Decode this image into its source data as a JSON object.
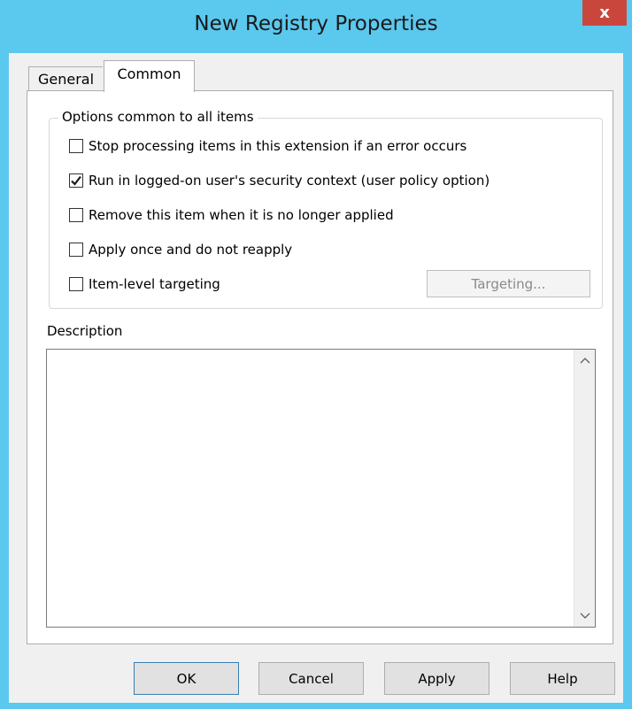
{
  "window": {
    "title": "New Registry Properties",
    "close_label": "x"
  },
  "tabs": [
    {
      "label": "General",
      "active": false
    },
    {
      "label": "Common",
      "active": true
    }
  ],
  "options_group": {
    "legend": "Options common to all items",
    "options": [
      {
        "label": "Stop processing items in this extension if an error occurs",
        "checked": false
      },
      {
        "label": "Run in logged-on user's security context (user policy option)",
        "checked": true
      },
      {
        "label": "Remove this item when it is no longer applied",
        "checked": false
      },
      {
        "label": "Apply once and do not reapply",
        "checked": false
      },
      {
        "label": "Item-level targeting",
        "checked": false
      }
    ],
    "targeting_button": "Targeting..."
  },
  "description": {
    "label": "Description",
    "value": ""
  },
  "buttons": {
    "ok": "OK",
    "cancel": "Cancel",
    "apply": "Apply",
    "help": "Help"
  },
  "colors": {
    "title_bar": "#5bc8ee",
    "close_button": "#c9463d",
    "dialog_background": "#f0f0f0"
  }
}
